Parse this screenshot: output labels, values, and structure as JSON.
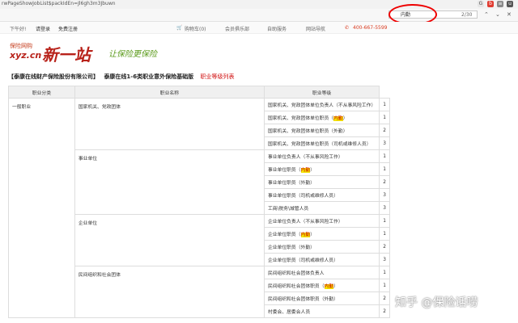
{
  "browser": {
    "url": "rwPageShowJobList$packIdEn=Jl6gh3m3Jbuwn",
    "find_query": "内勤",
    "find_count": "2/30"
  },
  "topnav": {
    "welcome": "下午好!",
    "login": "请登录",
    "register": "免费注册",
    "cart": "购物车(0)",
    "member": "会员俱乐部",
    "service": "自助服务",
    "sitenav": "网站导航",
    "phone": "400-667-5599"
  },
  "logo": {
    "small": "保险网购",
    "domain": "xyz.cn",
    "big": "新一站",
    "slogan": "让保险更保险"
  },
  "page": {
    "company": "【泰康在线财产保险股份有限公司】",
    "product": "泰康在线1-6类职业意外保险基础版",
    "tab": "职业等级列表"
  },
  "table": {
    "headers": [
      "职业分类",
      "职业名称",
      "职业等级"
    ],
    "category1": "一般职业",
    "groups": [
      {
        "name": "国家机关、党政团体",
        "rows": [
          {
            "pre": "国家机关、党政团体单位负责人（不从事风险工作）",
            "hl": "",
            "post": "",
            "level": "1"
          },
          {
            "pre": "国家机关、党政团体单位职员（",
            "hl": "内勤",
            "post": "）",
            "level": "1"
          },
          {
            "pre": "国家机关、党政团体单位职员（外勤）",
            "hl": "",
            "post": "",
            "level": "2"
          },
          {
            "pre": "国家机关、党政团体单位职员（司机或维修人员）",
            "hl": "",
            "post": "",
            "level": "3"
          }
        ]
      },
      {
        "name": "事业单位",
        "rows": [
          {
            "pre": "事业单位负责人（不从事风险工作）",
            "hl": "",
            "post": "",
            "level": "1"
          },
          {
            "pre": "事业单位职员（",
            "hl": "内勤",
            "post": "）",
            "level": "1"
          },
          {
            "pre": "事业单位职员（外勤）",
            "hl": "",
            "post": "",
            "level": "2"
          },
          {
            "pre": "事业单位职员（司机或维修人员）",
            "hl": "",
            "post": "",
            "level": "3"
          },
          {
            "pre": "工商\\税务\\城管人员",
            "hl": "",
            "post": "",
            "level": "3"
          }
        ]
      },
      {
        "name": "企业单位",
        "rows": [
          {
            "pre": "企业单位负责人（不从事风险工作）",
            "hl": "",
            "post": "",
            "level": "1"
          },
          {
            "pre": "企业单位职员（",
            "hl": "内勤",
            "post": "）",
            "level": "1"
          },
          {
            "pre": "企业单位职员（外勤）",
            "hl": "",
            "post": "",
            "level": "2"
          },
          {
            "pre": "企业单位职员（司机或维修人员）",
            "hl": "",
            "post": "",
            "level": "3"
          }
        ]
      },
      {
        "name": "民间组织和社会团体",
        "rows": [
          {
            "pre": "民间组织和社会团体负责人",
            "hl": "",
            "post": "",
            "level": "1"
          },
          {
            "pre": "民间组织和社会团体职员（",
            "hl": "内勤",
            "post": "）",
            "level": "1"
          },
          {
            "pre": "民间组织和社会团体职员（外勤）",
            "hl": "",
            "post": "",
            "level": "2"
          },
          {
            "pre": "村委会、居委会人员",
            "hl": "",
            "post": "",
            "level": "2"
          }
        ]
      }
    ]
  },
  "watermark": "知乎 @保险话唠"
}
